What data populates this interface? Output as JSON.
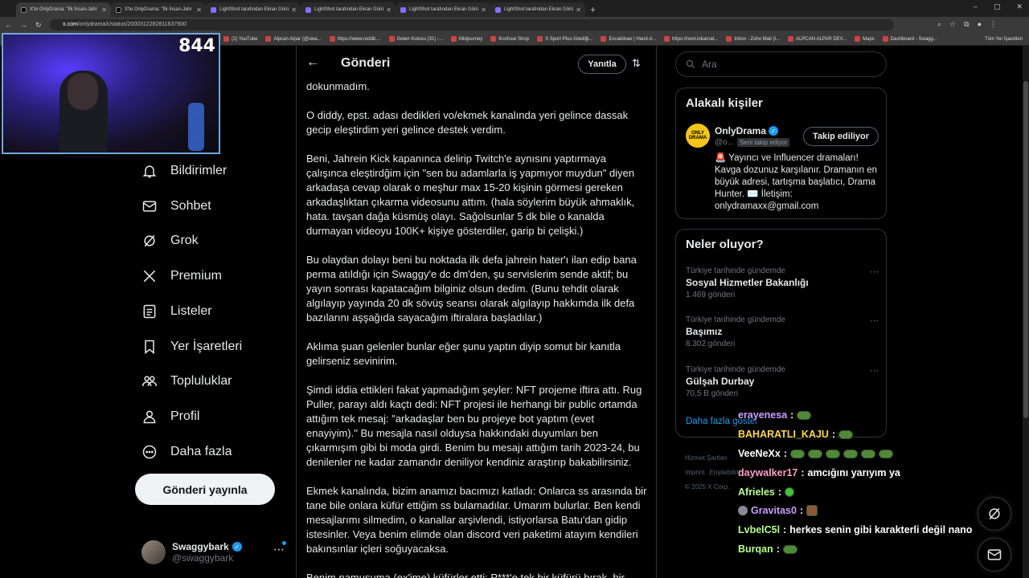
{
  "browser": {
    "tabs": [
      {
        "label": "X'te OnlyDrama: \"İlk İnsan-Jahr",
        "icon": "x-logo"
      },
      {
        "label": "X'te OnlyDrama: \"İlk İnsan-Jahr",
        "icon": "x-logo"
      },
      {
        "label": "LightShot tarafından Ekran Görü",
        "icon": "lightshot-icon"
      },
      {
        "label": "LightShot tarafından Ekran Görü",
        "icon": "lightshot-icon"
      },
      {
        "label": "LightShot tarafından Ekran Görü",
        "icon": "lightshot-icon"
      },
      {
        "label": "LightShot tarafından Ekran Görü",
        "icon": "lightshot-icon"
      }
    ],
    "url_host": "x.com",
    "url_path": "/onlydramaX/status/2000312282811637900",
    "bookmarks": [
      "(2) YouTube",
      "Alpcan Alpar (@swa...",
      "https://www.reddit....",
      "Gelen Kutusu (31) -...",
      "Midjourney",
      "Konfuse Shop",
      "S Sport Plus-İstediği...",
      "Excalidraw | Hand-d...",
      "https://next.inkarnat...",
      "Inbox - Zoho Mail (I...",
      "ALPCAN ALPAR DEV...",
      "Maps",
      "Dashboard - Swagg..."
    ],
    "bookmarks_right": "Tüm Yer İşaretleri"
  },
  "webcam": {
    "counter": "844"
  },
  "nav": {
    "items": [
      {
        "label": "Bildirimler",
        "icon": "bell-icon"
      },
      {
        "label": "Sohbet",
        "icon": "mail-icon"
      },
      {
        "label": "Grok",
        "icon": "grok-icon"
      },
      {
        "label": "Premium",
        "icon": "x-logo-icon"
      },
      {
        "label": "Listeler",
        "icon": "list-icon"
      },
      {
        "label": "Yer İşaretleri",
        "icon": "bookmark-icon"
      },
      {
        "label": "Topluluklar",
        "icon": "communities-icon"
      },
      {
        "label": "Profil",
        "icon": "profile-icon"
      },
      {
        "label": "Daha fazla",
        "icon": "more-circle-icon"
      }
    ],
    "post_button": "Gönderi yayınla",
    "profile": {
      "name": "Swaggybark",
      "handle": "@swaggybark"
    }
  },
  "post": {
    "header_title": "Gönderi",
    "reply_button": "Yanıtla",
    "paragraphs": [
      "dokunmadım.",
      "O diddy, epst. adası dedikleri vo/ekmek kanalında yeri gelince dassak gecip eleştirdim yeri gelince destek verdim.",
      "Beni, Jahrein Kick kapanınca delirip Twitch'e aynısını yaptırmaya çalışınca eleştirdğim için \"sen bu adamlarla iş yapmıyor muydun\" diyen arkadaşa cevap olarak o meşhur max 15-20 kişinin görmesi gereken arkadaşlıktan çıkarma videosunu attım. (hala söylerim büyük ahmaklık, hata. tavşan dağa küsmüş olayı. Sağolsunlar 5 dk bile o kanalda durmayan videoyu 100K+ kişiye gösterdiler, garip bi çelişki.)",
      "Bu olaydan dolayı beni bu noktada ilk defa jahrein hater'ı ilan edip bana perma atıldığı için Swaggy'e dc dm'den, şu servislerim sende aktif; bu yayın sonrası kapatacağım bilginiz olsun dedim. (Bunu tehdit olarak algılayıp yayında 20 dk sövüş seansı olarak algılayıp hakkımda ilk defa bazılarını aşşağıda sayacağım iftiralara başladılar.)",
      "Aklıma şuan gelenler bunlar eğer şunu yaptın diyip somut bir kanıtla gelirseniz sevinirim.",
      "Şimdi iddia ettikleri fakat yapmadığım şeyler: NFT projeme iftira attı. Rug Puller, parayı aldı kaçtı dedi: NFT projesi ile herhangi bir public ortamda attığım tek mesaj: \"arkadaşlar ben bu projeye bot yaptım (evet enayiyim).\"  Bu mesajla nasıl olduysa hakkındaki duyumları ben çıkarmışım gibi bi moda girdi. Benim bu mesajı attığım tarih 2023-24, bu denilenler ne kadar zamandır deniliyor kendiniz araştırıp bakabilirsiniz.",
      "Ekmek kanalında, bizim anamızı bacımızı katladı: Onlarca ss arasında bir tane bile onlara küfür ettiğim ss bulamadılar. Umarım bulurlar. Ben kendi mesajlarımı silmedim, o kanallar arşivlendi, istiyorlarsa Batu'dan gidip istesinler. Veya benim elimde olan discord veri paketimi atayım kendileri bakınsınlar içleri soğuyacaksa.",
      "Benim namusuma (ex'ime) küfürler etti: P***'e tek bir küfürü bırak, bir"
    ]
  },
  "right": {
    "search_placeholder": "Ara",
    "related_title": "Alakalı kişiler",
    "related": {
      "name": "OnlyDrama",
      "handle": "@o...",
      "follows_you": "Seni takip ediyor",
      "follow_button": "Takip ediliyor",
      "avatar_text": "ONLY DRAMA",
      "bio": "🚨 Yayıncı ve Influencer dramaları! Kavga dozunuz karşılanır. Dramanın en büyük adresi, tartışma başlatıcı, Drama Hunter. ✉️ İletişim: onlydramaxx@gmail.com"
    },
    "trends_title": "Neler oluyor?",
    "trends": [
      {
        "context": "Türkiye tarihinde gündemde",
        "topic": "Sosyal Hizmetler Bakanlığı",
        "count": "1.469 gönderi"
      },
      {
        "context": "Türkiye tarihinde gündemde",
        "topic": "Başımız",
        "count": "8.302 gönderi"
      },
      {
        "context": "Türkiye tarihinde gündemde",
        "topic": "Gülşah Durbay",
        "count": "70,5 B gönderi"
      }
    ],
    "show_more": "Daha fazla göster",
    "footer": [
      "Hizmet Şartları",
      "Imprint",
      "Erişilebilirlik",
      "© 2025 X Corp."
    ]
  },
  "chat": [
    {
      "user": "erayenesa",
      "color": "#c9a0ff",
      "text": "",
      "emotes": [
        "frog"
      ]
    },
    {
      "user": "BAHARATLI_KAJU",
      "color": "#ffd84a",
      "text": "",
      "emotes": [
        "frog"
      ]
    },
    {
      "user": "VeeNeXx",
      "color": "#ffffff",
      "text": "",
      "emotes": [
        "frog",
        "frog",
        "frog",
        "frog",
        "frog",
        "frog"
      ]
    },
    {
      "user": "daywalker17",
      "color": "#ff9ec7",
      "text": "amcığını yarıyım ya",
      "emotes": []
    },
    {
      "user": "Afrieles",
      "color": "#b6ff8a",
      "text": "",
      "emotes": [
        "green"
      ]
    },
    {
      "user": "Gravitas0",
      "color": "#c99bff",
      "text": "",
      "emotes": [
        "cup"
      ]
    },
    {
      "user": "LvbelC5l",
      "color": "#b6ff8a",
      "text": "herkes senin gibi karakterli değil nano",
      "emotes": []
    },
    {
      "user": "Burqan",
      "color": "#b6ff8a",
      "text": "",
      "emotes": [
        "frog"
      ]
    }
  ]
}
